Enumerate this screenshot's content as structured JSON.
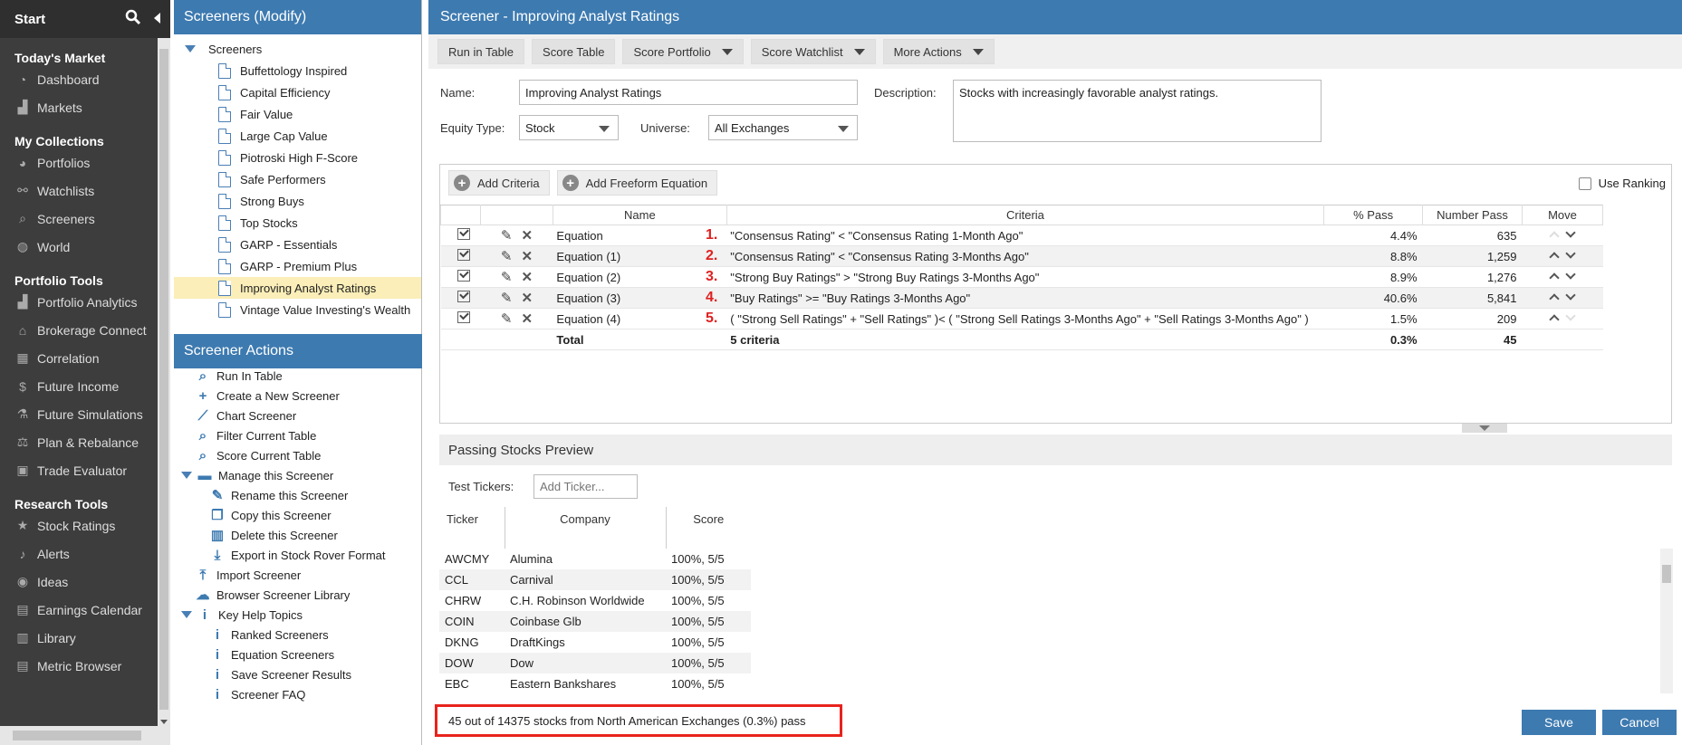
{
  "nav": {
    "start": "Start",
    "sections": [
      {
        "title": "Today's Market",
        "items": [
          "Dashboard",
          "Markets"
        ]
      },
      {
        "title": "My Collections",
        "items": [
          "Portfolios",
          "Watchlists",
          "Screeners",
          "World"
        ]
      },
      {
        "title": "Portfolio Tools",
        "items": [
          "Portfolio Analytics",
          "Brokerage Connect",
          "Correlation",
          "Future Income",
          "Future Simulations",
          "Plan & Rebalance",
          "Trade Evaluator"
        ]
      },
      {
        "title": "Research Tools",
        "items": [
          "Stock Ratings",
          "Alerts",
          "Ideas",
          "Earnings Calendar",
          "Library",
          "Metric Browser"
        ]
      }
    ]
  },
  "screeners": {
    "header": "Screeners (Modify)",
    "root": "Screeners",
    "items": [
      "Buffettology Inspired",
      "Capital Efficiency",
      "Fair Value",
      "Large Cap Value",
      "Piotroski High F-Score",
      "Safe Performers",
      "Strong Buys",
      "Top Stocks",
      "GARP - Essentials",
      "GARP - Premium Plus",
      "Improving Analyst Ratings",
      "Vintage Value Investing's Wealth"
    ],
    "selected": "Improving Analyst Ratings"
  },
  "actions": {
    "header": "Screener Actions",
    "items": [
      "Run In Table",
      "Create a New Screener",
      "Chart Screener",
      "Filter Current Table",
      "Score Current Table",
      "Manage this Screener",
      "Rename this Screener",
      "Copy this Screener",
      "Delete this Screener",
      "Export in Stock Rover Format",
      "Import Screener",
      "Browser Screener Library",
      "Key Help Topics",
      "Ranked Screeners",
      "Equation Screeners",
      "Save Screener Results",
      "Screener FAQ"
    ]
  },
  "main": {
    "title": "Screener - Improving Analyst Ratings",
    "toolbar": [
      "Run in Table",
      "Score Table",
      "Score Portfolio",
      "Score Watchlist",
      "More Actions"
    ],
    "name_label": "Name:",
    "name_value": "Improving Analyst Ratings",
    "description_label": "Description:",
    "description_value": "Stocks with increasingly favorable analyst ratings.",
    "equity_label": "Equity Type:",
    "equity_value": "Stock",
    "universe_label": "Universe:",
    "universe_value": "All Exchanges",
    "add_criteria": "Add Criteria",
    "add_freeform": "Add Freeform Equation",
    "use_ranking": "Use Ranking"
  },
  "criteria": {
    "headers": [
      "Name",
      "Criteria",
      "% Pass",
      "Number Pass",
      "Move"
    ],
    "rows": [
      {
        "name": "Equation",
        "num": "1.",
        "criteria": "\"Consensus Rating\" < \"Consensus Rating 1-Month Ago\"",
        "pct": "4.4%",
        "count": "635"
      },
      {
        "name": "Equation (1)",
        "num": "2.",
        "criteria": "\"Consensus Rating\" < \"Consensus Rating 3-Months Ago\"",
        "pct": "8.8%",
        "count": "1,259"
      },
      {
        "name": "Equation (2)",
        "num": "3.",
        "criteria": "\"Strong Buy Ratings\" > \"Strong Buy Ratings 3-Months Ago\"",
        "pct": "8.9%",
        "count": "1,276"
      },
      {
        "name": "Equation (3)",
        "num": "4.",
        "criteria": "\"Buy Ratings\" >= \"Buy Ratings 3-Months Ago\"",
        "pct": "40.6%",
        "count": "5,841"
      },
      {
        "name": "Equation (4)",
        "num": "5.",
        "criteria": "( \"Strong Sell Ratings\" + \"Sell Ratings\" )< ( \"Strong Sell Ratings 3-Months Ago\" + \"Sell Ratings 3-Months Ago\" )",
        "pct": "1.5%",
        "count": "209"
      }
    ],
    "total": {
      "name": "Total",
      "criteria": "5 criteria",
      "pct": "0.3%",
      "count": "45"
    }
  },
  "preview": {
    "header": "Passing Stocks Preview",
    "test_label": "Test Tickers:",
    "test_placeholder": "Add Ticker...",
    "columns": [
      "Ticker",
      "Company",
      "Score"
    ],
    "rows": [
      {
        "ticker": "AWCMY",
        "company": "Alumina",
        "score": "100%, 5/5"
      },
      {
        "ticker": "CCL",
        "company": "Carnival",
        "score": "100%, 5/5"
      },
      {
        "ticker": "CHRW",
        "company": "C.H. Robinson Worldwide",
        "score": "100%, 5/5"
      },
      {
        "ticker": "COIN",
        "company": "Coinbase Glb",
        "score": "100%, 5/5"
      },
      {
        "ticker": "DKNG",
        "company": "DraftKings",
        "score": "100%, 5/5"
      },
      {
        "ticker": "DOW",
        "company": "Dow",
        "score": "100%, 5/5"
      },
      {
        "ticker": "EBC",
        "company": "Eastern Bankshares",
        "score": "100%, 5/5"
      }
    ]
  },
  "footer": {
    "status": "45 out of 14375 stocks from North American Exchanges (0.3%) pass",
    "save": "Save",
    "cancel": "Cancel"
  },
  "colors": {
    "header_blue": "#3d7ab0",
    "nav_bg": "#3d3d3d",
    "selected": "#fbeeb8",
    "highlight_red": "#e8231d"
  }
}
